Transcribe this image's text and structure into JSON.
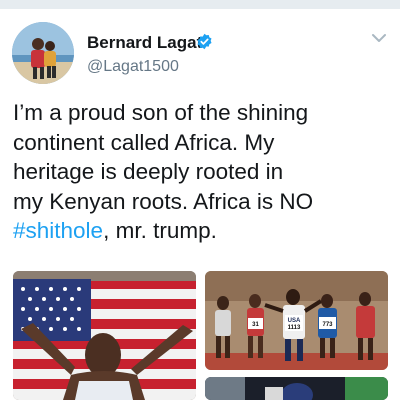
{
  "tweet": {
    "author": {
      "name": "Bernard Lagat",
      "handle": "@Lagat1500",
      "verified": true
    },
    "text_lines": [
      "I’m a proud son of the shining",
      "continent called Africa. My",
      "heritage is deeply rooted in",
      "my Kenyan roots. Africa is NO"
    ],
    "hashtag": "#shithole",
    "text_tail": ", mr. trump.",
    "media": [
      {
        "description_icon": "photo-athlete-with-usa-flag"
      },
      {
        "description_icon": "photo-race-runners",
        "bib_numbers": [
          "USA",
          "1113",
          "773",
          "31"
        ]
      },
      {
        "description_icon": "photo-runner"
      }
    ]
  },
  "icons": {
    "verified": "verified-badge-icon",
    "more": "chevron-down-icon"
  },
  "colors": {
    "text": "#14171a",
    "secondary": "#657786",
    "link": "#1da1f2",
    "divider": "#e6ecf0"
  }
}
